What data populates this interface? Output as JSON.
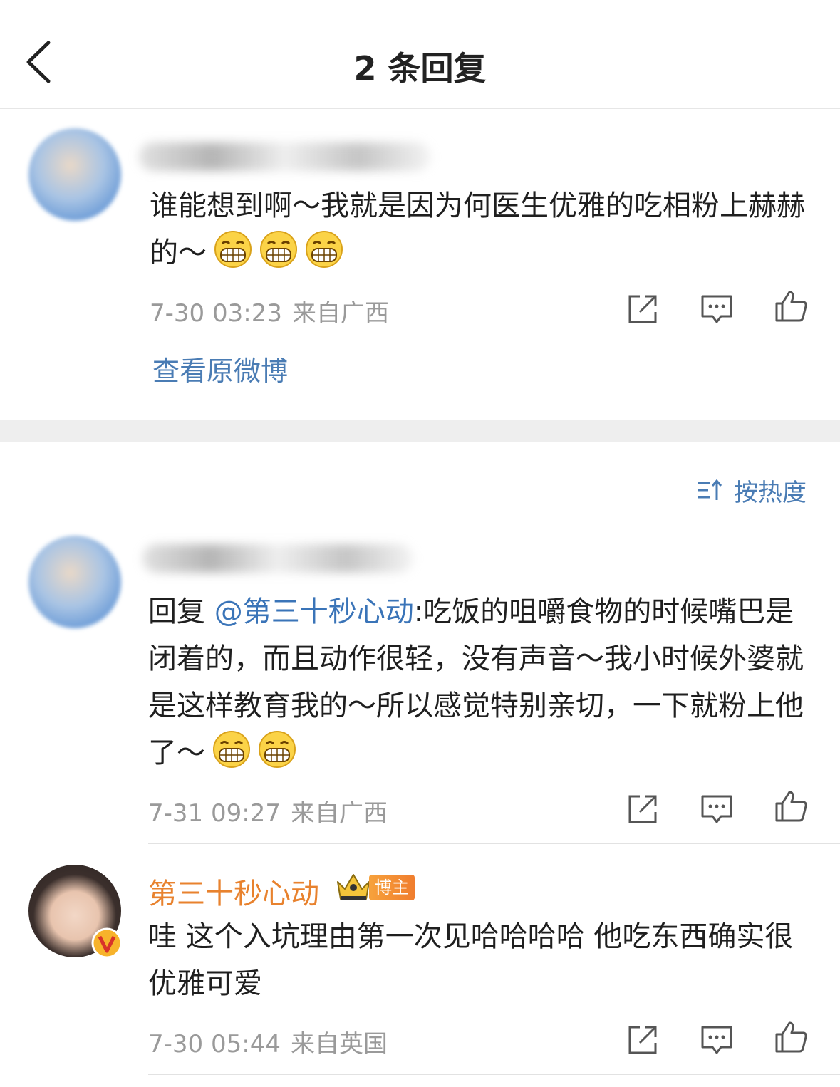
{
  "header": {
    "title": "2 条回复"
  },
  "original": {
    "text": "谁能想到啊～我就是因为何医生优雅的吃相粉上赫赫的～",
    "date": "7-30 03:23",
    "location": "来自广西",
    "view_link": "查看原微博"
  },
  "sort": {
    "label": "按热度"
  },
  "replies": [
    {
      "prefix": "回复 ",
      "mention": "@第三十秒心动",
      "text": ":吃饭的咀嚼食物的时候嘴巴是闭着的，而且动作很轻，没有声音～我小时候外婆就是这样教育我的～所以感觉特别亲切，一下就粉上他了～",
      "date": "7-31 09:27",
      "location": "来自广西"
    },
    {
      "name": "第三十秒心动",
      "badge": "博主",
      "text": "哇 这个入坑理由第一次见哈哈哈哈 他吃东西确实很优雅可爱",
      "date": "7-30 05:44",
      "location": "来自英国"
    }
  ],
  "icons": [
    "back-icon",
    "share-icon",
    "comment-icon",
    "like-icon",
    "sort-icon",
    "grin-emoji-icon",
    "crown-icon",
    "verified-v-icon"
  ],
  "colors": {
    "link": "#4a7cb4",
    "blogger_name": "#e8822e",
    "meta": "#9a9a9a",
    "badge": "#f08a33"
  }
}
